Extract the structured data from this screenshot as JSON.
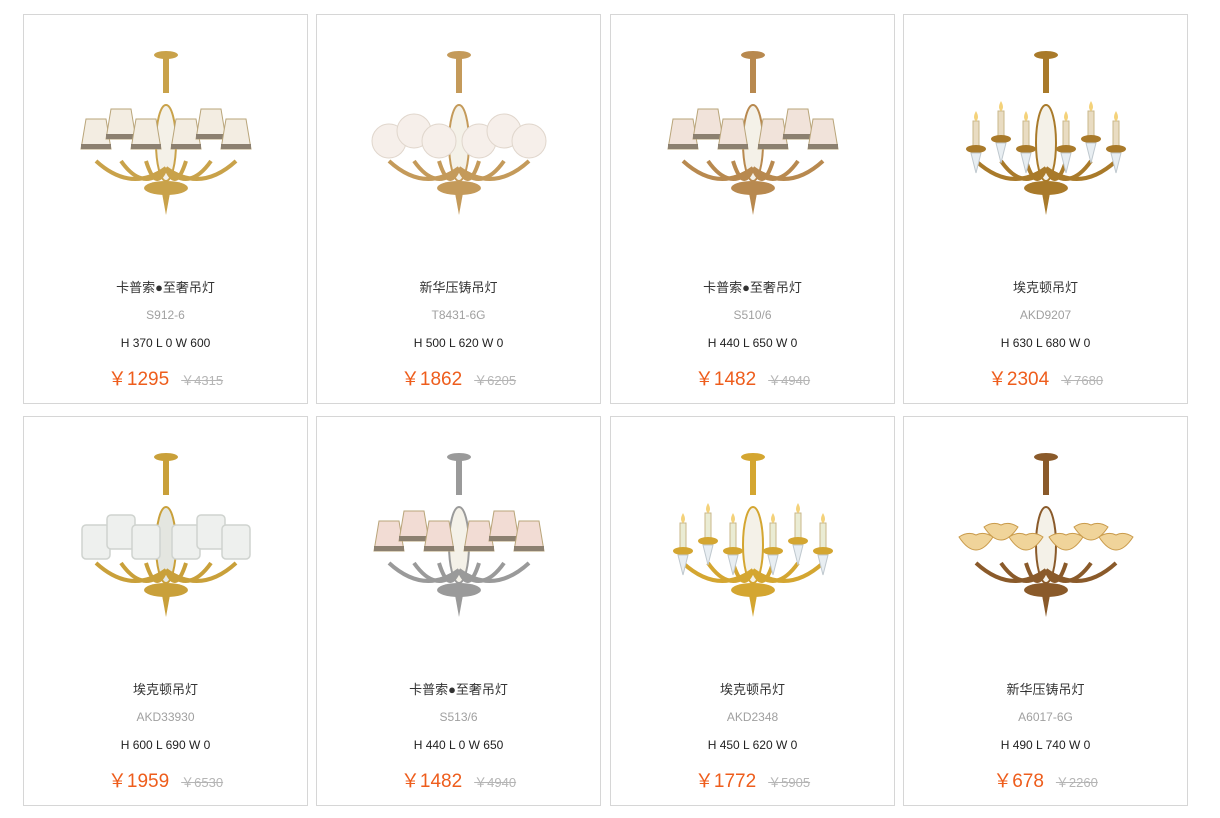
{
  "products": [
    {
      "name": "卡普索●至奢吊灯",
      "model": "S912-6",
      "dims": "H 370 L 0 W 600",
      "price": "￥1295",
      "old_price": "￥4315",
      "shade": "#f3ede2",
      "metal": "#c9a24a",
      "style": "fabric"
    },
    {
      "name": "新华压铸吊灯",
      "model": "T8431-6G",
      "dims": "H 500 L 620 W 0",
      "price": "￥1862",
      "old_price": "￥6205",
      "shade": "#f6efea",
      "metal": "#c49a5a",
      "style": "globe"
    },
    {
      "name": "卡普索●至奢吊灯",
      "model": "S510/6",
      "dims": "H 440 L 650 W 0",
      "price": "￥1482",
      "old_price": "￥4940",
      "shade": "#f1e3da",
      "metal": "#b8894f",
      "style": "fabric"
    },
    {
      "name": "埃克顿吊灯",
      "model": "AKD9207",
      "dims": "H 630 L 680 W 0",
      "price": "￥2304",
      "old_price": "￥7680",
      "shade": "#e9dcc2",
      "metal": "#a97a2a",
      "style": "candle"
    },
    {
      "name": "埃克顿吊灯",
      "model": "AKD33930",
      "dims": "H 600 L 690 W 0",
      "price": "￥1959",
      "old_price": "￥6530",
      "shade": "#eef0ee",
      "metal": "#c9a03a",
      "style": "drum"
    },
    {
      "name": "卡普索●至奢吊灯",
      "model": "S513/6",
      "dims": "H 440 L 0 W 650",
      "price": "￥1482",
      "old_price": "￥4940",
      "shade": "#f2dcd4",
      "metal": "#9a9a9a",
      "style": "fabric"
    },
    {
      "name": "埃克顿吊灯",
      "model": "AKD2348",
      "dims": "H 450 L 620 W 0",
      "price": "￥1772",
      "old_price": "￥5905",
      "shade": "#eaecd4",
      "metal": "#d4a631",
      "style": "candle"
    },
    {
      "name": "新华压铸吊灯",
      "model": "A6017-6G",
      "dims": "H 490 L 740 W 0",
      "price": "￥678",
      "old_price": "￥2260",
      "shade": "#f0d49a",
      "metal": "#8a5a2a",
      "style": "tulip"
    }
  ]
}
